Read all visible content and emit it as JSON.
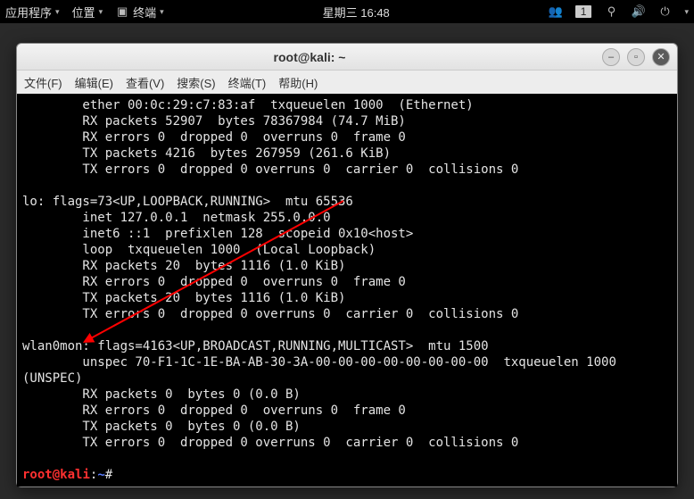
{
  "topbar": {
    "apps": "应用程序",
    "places": "位置",
    "terminal": "终端",
    "datetime": "星期三 16:48",
    "workspace": "1"
  },
  "window": {
    "title": "root@kali: ~",
    "menu": {
      "file": "文件(F)",
      "edit": "编辑(E)",
      "view": "查看(V)",
      "search": "搜索(S)",
      "terminal": "终端(T)",
      "help": "帮助(H)"
    }
  },
  "terminal": {
    "lines": [
      "        ether 00:0c:29:c7:83:af  txqueuelen 1000  (Ethernet)",
      "        RX packets 52907  bytes 78367984 (74.7 MiB)",
      "        RX errors 0  dropped 0  overruns 0  frame 0",
      "        TX packets 4216  bytes 267959 (261.6 KiB)",
      "        TX errors 0  dropped 0 overruns 0  carrier 0  collisions 0",
      "",
      "lo: flags=73<UP,LOOPBACK,RUNNING>  mtu 65536",
      "        inet 127.0.0.1  netmask 255.0.0.0",
      "        inet6 ::1  prefixlen 128  scopeid 0x10<host>",
      "        loop  txqueuelen 1000  (Local Loopback)",
      "        RX packets 20  bytes 1116 (1.0 KiB)",
      "        RX errors 0  dropped 0  overruns 0  frame 0",
      "        TX packets 20  bytes 1116 (1.0 KiB)",
      "        TX errors 0  dropped 0 overruns 0  carrier 0  collisions 0",
      "",
      "wlan0mon: flags=4163<UP,BROADCAST,RUNNING,MULTICAST>  mtu 1500",
      "        unspec 70-F1-1C-1E-BA-AB-30-3A-00-00-00-00-00-00-00-00  txqueuelen 1000  ",
      "(UNSPEC)",
      "        RX packets 0  bytes 0 (0.0 B)",
      "        RX errors 0  dropped 0  overruns 0  frame 0",
      "        TX packets 0  bytes 0 (0.0 B)",
      "        TX errors 0  dropped 0 overruns 0  carrier 0  collisions 0",
      ""
    ],
    "prompt": {
      "user": "root",
      "at": "@",
      "host": "kali",
      "sep": ":",
      "path": "~",
      "hash": "#"
    }
  },
  "annotation": {
    "arrow_color": "#ff0000"
  }
}
